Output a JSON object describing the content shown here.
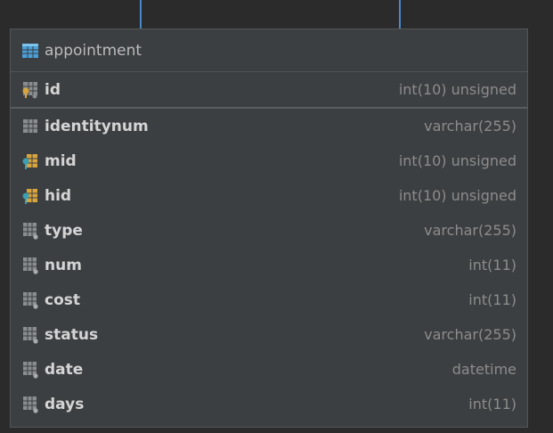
{
  "table": {
    "title": "appointment",
    "primary_key": {
      "name": "id",
      "type": "int(10) unsigned",
      "icon": "primary-key-column-icon"
    },
    "columns": [
      {
        "name": "identitynum",
        "type": "varchar(255)",
        "icon": "column-icon"
      },
      {
        "name": "mid",
        "type": "int(10) unsigned",
        "icon": "foreign-key-column-icon"
      },
      {
        "name": "hid",
        "type": "int(10) unsigned",
        "icon": "foreign-key-column-icon"
      },
      {
        "name": "type",
        "type": "varchar(255)",
        "icon": "nullable-column-icon"
      },
      {
        "name": "num",
        "type": "int(11)",
        "icon": "nullable-column-icon"
      },
      {
        "name": "cost",
        "type": "int(11)",
        "icon": "nullable-column-icon"
      },
      {
        "name": "status",
        "type": "varchar(255)",
        "icon": "nullable-column-icon"
      },
      {
        "name": "date",
        "type": "datetime",
        "icon": "nullable-column-icon"
      },
      {
        "name": "days",
        "type": "int(11)",
        "icon": "nullable-column-icon"
      }
    ]
  },
  "colors": {
    "background": "#2b2b2b",
    "panel": "#3c3f41",
    "connector": "#4a88c7",
    "column_name": "#d4d4d4",
    "column_type": "#8c8c8c",
    "table_icon": "#4a9fd8",
    "key_gold": "#d7a43d",
    "key_teal": "#3aa0b5"
  }
}
